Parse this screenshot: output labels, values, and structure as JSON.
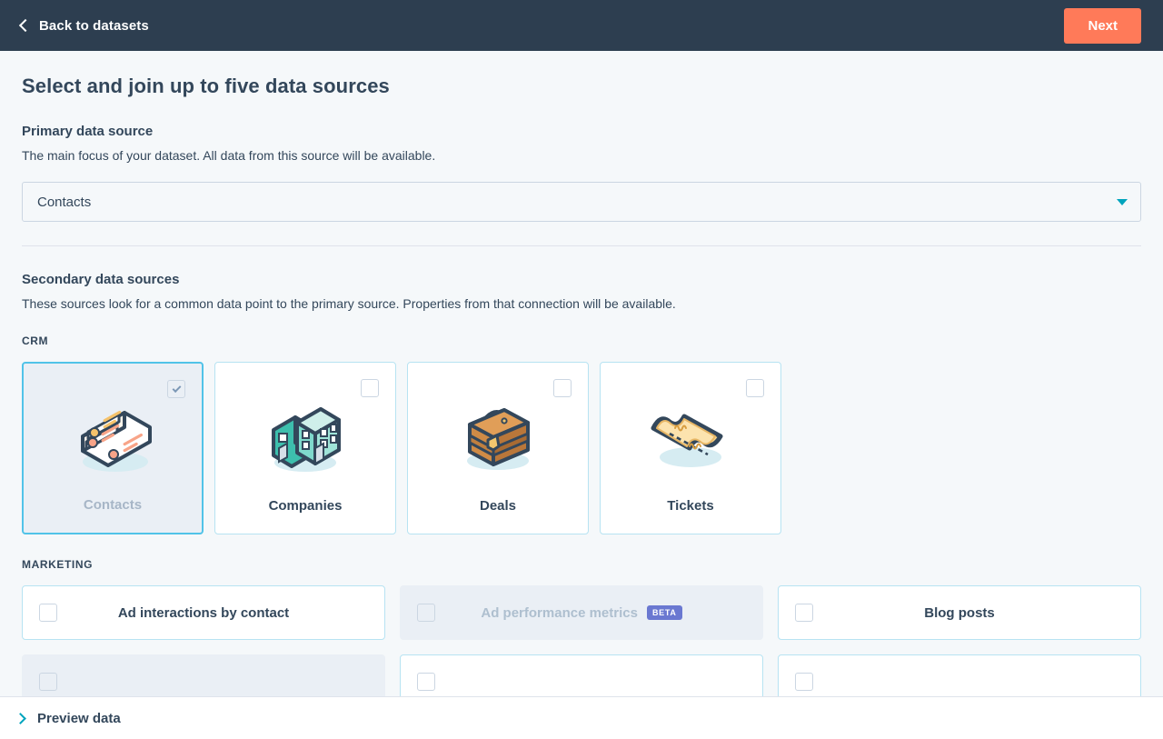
{
  "topbar": {
    "back_label": "Back to datasets",
    "back_icon": "chevron-left-icon",
    "next_label": "Next",
    "next_color": "#FF7A59",
    "background": "#2D3E50"
  },
  "page": {
    "title": "Select and join up to five data sources"
  },
  "primary": {
    "heading": "Primary data source",
    "description": "The main focus of your dataset. All data from this source will be available.",
    "selected_value": "Contacts",
    "caret_icon": "caret-down-icon",
    "caret_color": "#00A4BD"
  },
  "secondary": {
    "heading": "Secondary data sources",
    "description": "These sources look for a common data point to the primary source. Properties from that connection will be available."
  },
  "crm": {
    "group_label": "CRM",
    "tiles": [
      {
        "label": "Contacts",
        "icon": "contacts-icon",
        "checked": true,
        "disabled": true
      },
      {
        "label": "Companies",
        "icon": "companies-icon",
        "checked": false,
        "disabled": false
      },
      {
        "label": "Deals",
        "icon": "deals-icon",
        "checked": false,
        "disabled": false
      },
      {
        "label": "Tickets",
        "icon": "tickets-icon",
        "checked": false,
        "disabled": false
      }
    ]
  },
  "marketing": {
    "group_label": "MARKETING",
    "cards": [
      {
        "label": "Ad interactions by contact",
        "badge": "",
        "disabled": false
      },
      {
        "label": "Ad performance metrics",
        "badge": "BETA",
        "disabled": true
      },
      {
        "label": "Blog posts",
        "badge": "",
        "disabled": false
      }
    ],
    "badge_color": "#6A78D1"
  },
  "footer": {
    "preview_label": "Preview data",
    "chevron_icon": "chevron-right-icon",
    "chevron_color": "#00A4BD"
  }
}
